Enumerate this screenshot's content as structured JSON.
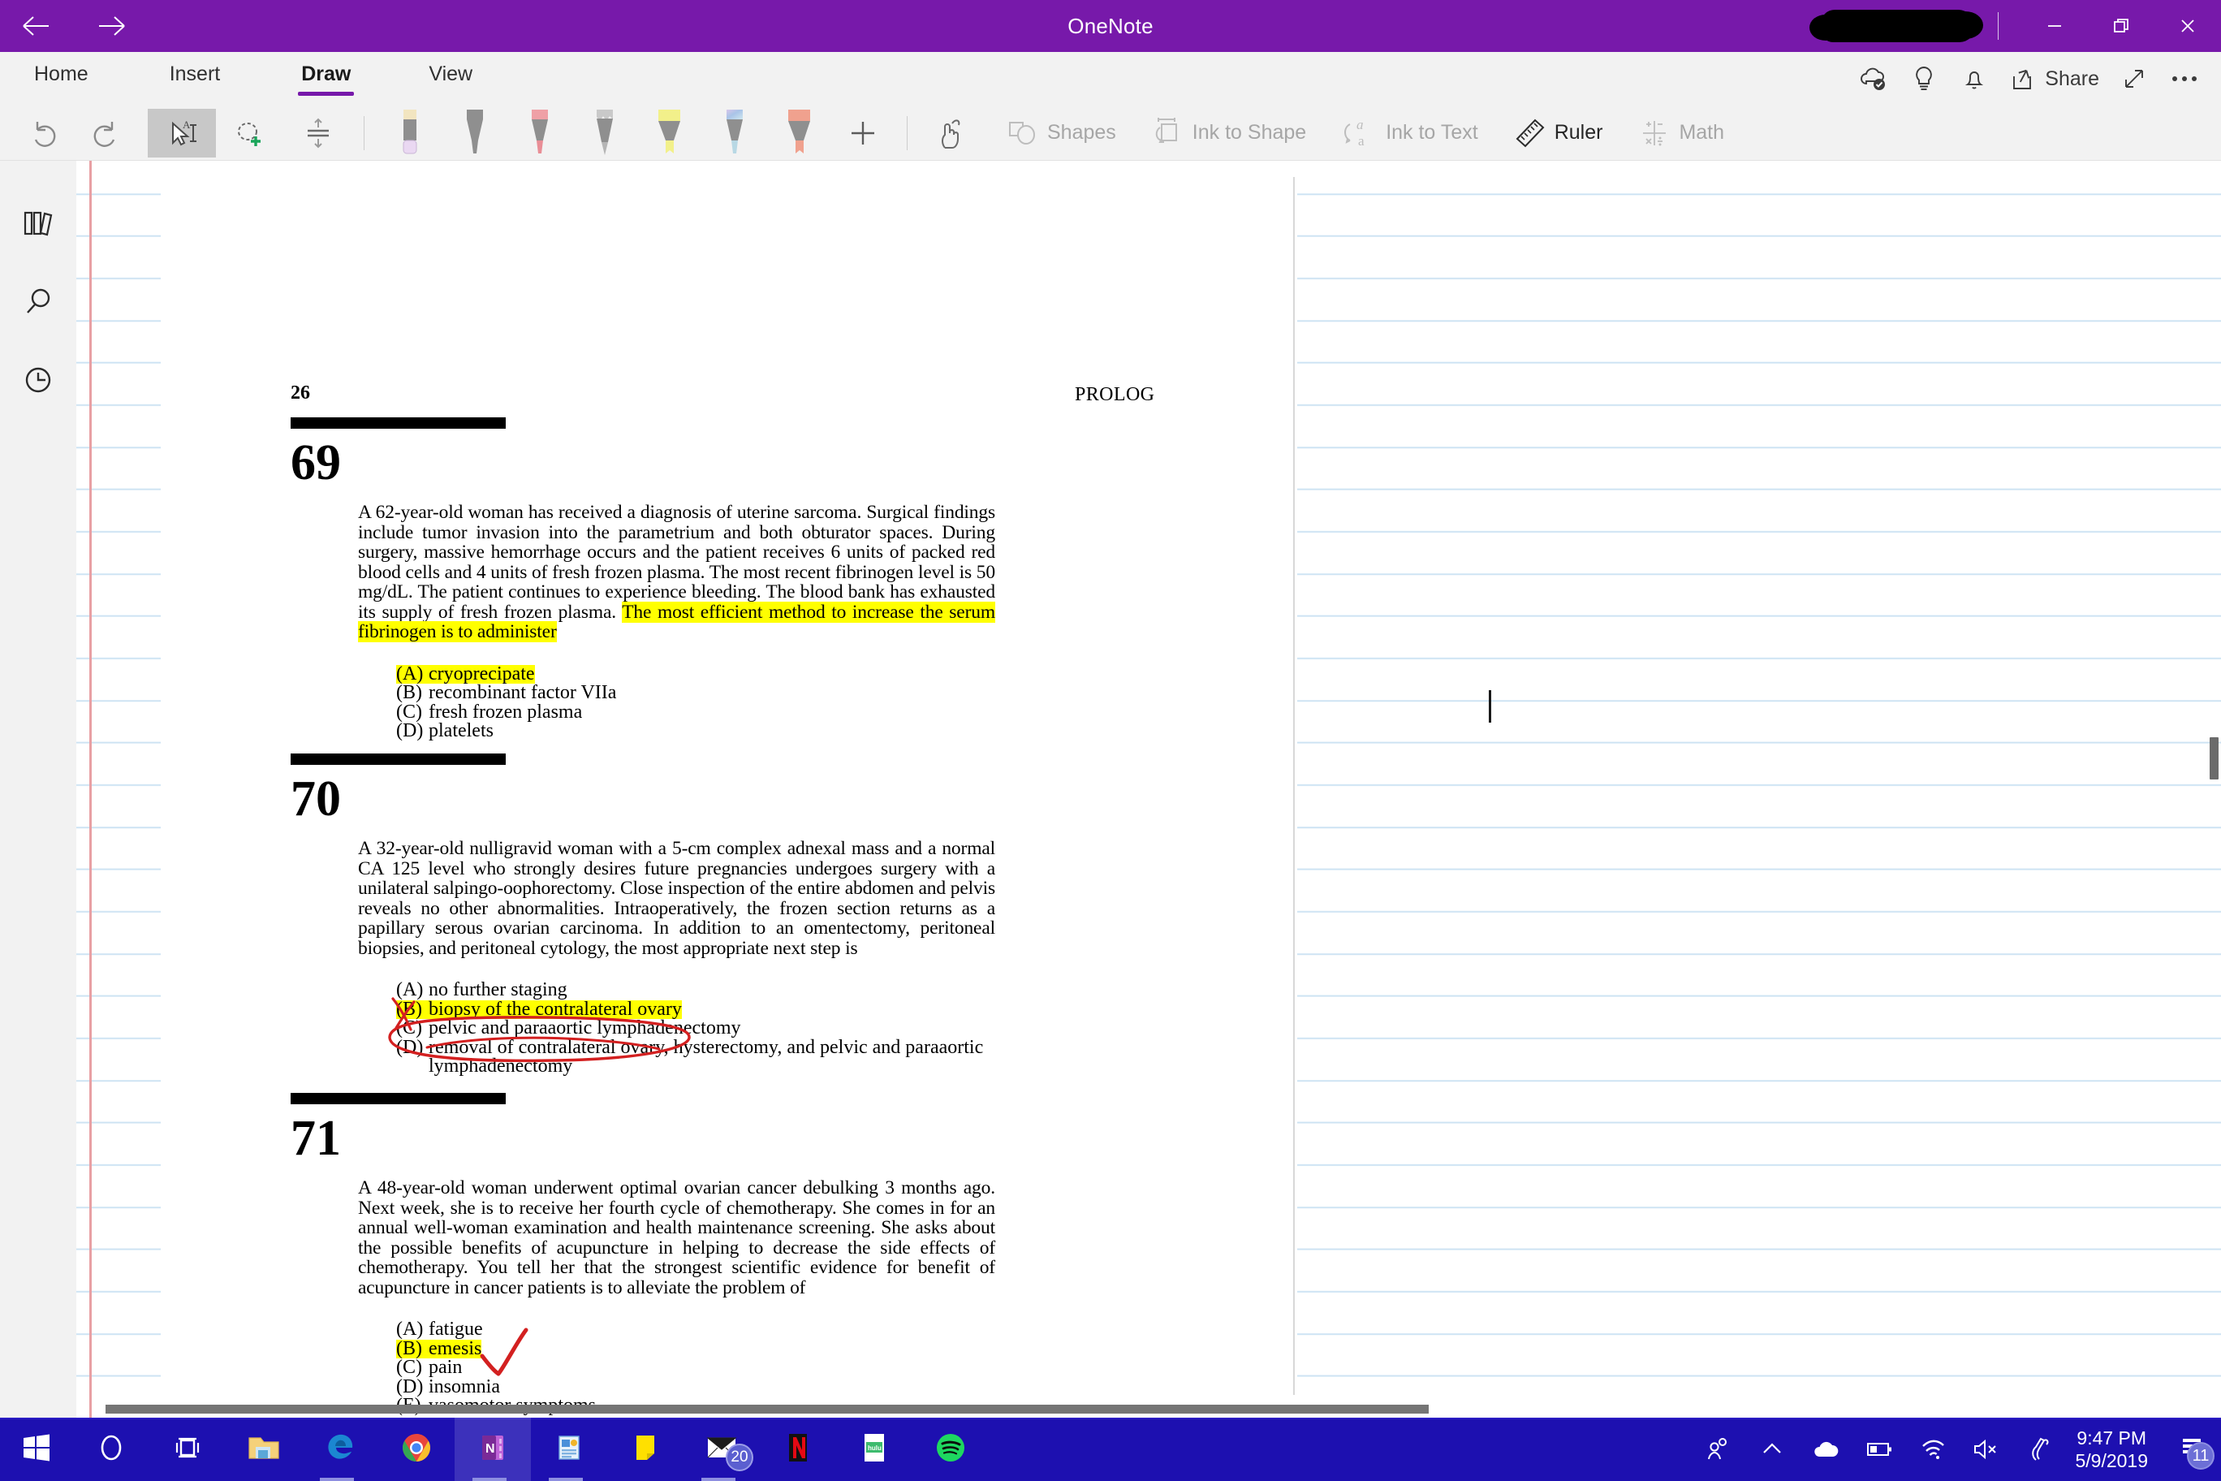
{
  "window": {
    "title": "OneNote",
    "back_icon": "back-arrow-icon",
    "forward_icon": "forward-arrow-icon",
    "minimize_label": "─",
    "restore_label": "❐",
    "close_label": "✕"
  },
  "ribbon": {
    "tabs": [
      {
        "label": "Home",
        "active": false
      },
      {
        "label": "Insert",
        "active": false
      },
      {
        "label": "Draw",
        "active": true
      },
      {
        "label": "View",
        "active": false
      }
    ],
    "right_actions": [
      {
        "label": "",
        "icon": "cloud-synced-icon"
      },
      {
        "label": "",
        "icon": "lightbulb-tellme-icon"
      },
      {
        "label": "",
        "icon": "bell-notification-icon"
      },
      {
        "label": "Share",
        "icon": "share-icon"
      },
      {
        "label": "",
        "icon": "expand-diagonal-icon"
      },
      {
        "label": "",
        "icon": "more-ellipsis-icon"
      }
    ]
  },
  "toolbar": {
    "undo": {
      "label": "",
      "icon": "undo-icon"
    },
    "redo": {
      "label": "",
      "icon": "redo-icon"
    },
    "type_select": {
      "label": "",
      "icon": "type-select-cursor-icon",
      "selected": true
    },
    "lasso_select": {
      "label": "",
      "icon": "lasso-select-icon"
    },
    "insert_space": {
      "label": "",
      "icon": "insert-space-icon"
    },
    "pens": [
      {
        "name": "eraser",
        "icon": "eraser-icon",
        "body": "#8b8b8b",
        "cap": "#f2e5c0",
        "tip": "#e8d5f0"
      },
      {
        "name": "pen-black",
        "icon": "pen-icon",
        "body": "#8b8b8b",
        "cap": "#8b8b8b",
        "tip": "#8b8b8b"
      },
      {
        "name": "pen-red",
        "icon": "pen-icon",
        "body": "#8b8b8b",
        "cap": "#efa0a6",
        "tip": "#e98e96"
      },
      {
        "name": "pencil-grey",
        "icon": "pencil-icon",
        "body": "#8b8b8b",
        "cap": "#c9c9c9",
        "tip": "#a8a8a8"
      },
      {
        "name": "highlighter-yellow",
        "icon": "highlighter-icon",
        "body": "#8b8b8b",
        "cap": "#f2f08a",
        "tip": "#f2f08a"
      },
      {
        "name": "pen-rainbow",
        "icon": "pen-icon",
        "body": "#8b8b8b",
        "cap": "#b9c9ea",
        "tip": "#b8d8e4"
      },
      {
        "name": "highlighter-orange",
        "icon": "highlighter-icon",
        "body": "#8b8b8b",
        "cap": "#f0a18e",
        "tip": "#f0a18e"
      }
    ],
    "add_pen": {
      "label": "+",
      "icon": "add-pen-icon"
    },
    "ink_to_select": {
      "label": "",
      "icon": "ink-finger-icon"
    },
    "shapes": {
      "label": "Shapes",
      "icon": "shapes-icon",
      "enabled": false
    },
    "ink_to_shape": {
      "label": "Ink to Shape",
      "icon": "ink-to-shape-icon",
      "enabled": false
    },
    "ink_to_text": {
      "label": "Ink to Text",
      "icon": "ink-to-text-icon",
      "enabled": false
    },
    "ruler": {
      "label": "Ruler",
      "icon": "ruler-icon",
      "enabled": true
    },
    "math": {
      "label": "Math",
      "icon": "math-icon",
      "enabled": false
    }
  },
  "rail": {
    "items": [
      {
        "name": "notebooks",
        "icon": "notebooks-icon"
      },
      {
        "name": "search",
        "icon": "search-icon"
      },
      {
        "name": "recent-notes",
        "icon": "clock-recent-icon"
      }
    ]
  },
  "document": {
    "page_number": "26",
    "running_head": "PROLOG",
    "questions": [
      {
        "number": "69",
        "stem_plain": "A 62-year-old woman has received a diagnosis of uterine sarcoma. Surgical findings include tumor invasion into the parametrium and both obturator spaces. During surgery, massive hemorrhage occurs and the patient receives 6 units of packed red blood cells and 4 units of fresh frozen plasma. The most recent fibrinogen level is 50 mg/dL. The patient continues to experience bleeding. The blood bank has exhausted its supply of fresh frozen plasma. ",
        "stem_highlight": "The most efficient method to increase the serum fibrinogen is to administer",
        "options": [
          {
            "letter": "(A)",
            "text": "cryoprecipate",
            "highlighted": true
          },
          {
            "letter": "(B)",
            "text": "recombinant factor VIIa",
            "highlighted": false
          },
          {
            "letter": "(C)",
            "text": "fresh frozen plasma",
            "highlighted": false
          },
          {
            "letter": "(D)",
            "text": "platelets",
            "highlighted": false
          }
        ]
      },
      {
        "number": "70",
        "stem_plain": "A 32-year-old nulligravid woman with a 5-cm complex adnexal mass and a normal CA 125 level who strongly desires future pregnancies undergoes surgery with a unilateral salpingo-oophorectomy. Close inspection of the entire abdomen and pelvis reveals no other abnormalities. Intraoperatively, the frozen section returns as a papillary serous ovarian carcinoma. In addition to an omentectomy, peritoneal biopsies, and peritoneal cytology, the most appropriate next step is",
        "stem_highlight": "",
        "options": [
          {
            "letter": "(A)",
            "text": "no further staging",
            "highlighted": false
          },
          {
            "letter": "(B)",
            "text": "biopsy of the contralateral ovary",
            "highlighted": true
          },
          {
            "letter": "(C)",
            "text": "pelvic and paraaortic lymphadenectomy",
            "highlighted": false
          },
          {
            "letter": "(D)",
            "text": "removal of contralateral ovary, hysterectomy, and pelvic and paraaortic lymphadenectomy",
            "highlighted": false
          }
        ]
      },
      {
        "number": "71",
        "stem_plain": "A 48-year-old woman underwent optimal ovarian cancer debulking 3 months ago. Next week, she is to receive her fourth cycle of chemotherapy. She comes in for an annual well-woman examination and health maintenance screening. She asks about the possible benefits of acupuncture in helping to decrease the side effects of chemotherapy. You tell her that the strongest scientific evidence for benefit of acupuncture in cancer patients is to alleviate the problem of",
        "stem_highlight": "",
        "options": [
          {
            "letter": "(A)",
            "text": "fatigue",
            "highlighted": false
          },
          {
            "letter": "(B)",
            "text": "emesis",
            "highlighted": true
          },
          {
            "letter": "(C)",
            "text": "pain",
            "highlighted": false
          },
          {
            "letter": "(D)",
            "text": "insomnia",
            "highlighted": false
          },
          {
            "letter": "(E)",
            "text": "vasomotor symptoms",
            "highlighted": false
          }
        ]
      }
    ],
    "annotations": [
      {
        "name": "red-x-over-option-b",
        "type": "x-mark",
        "color": "#d32020"
      },
      {
        "name": "red-circle-around-option-c",
        "type": "ellipse",
        "color": "#d32020"
      },
      {
        "name": "red-checkmark-next-to-emesis",
        "type": "check",
        "color": "#d32020"
      }
    ]
  },
  "colors": {
    "brand_purple": "#7719aa",
    "ribbon_bg": "#f2f2f2",
    "taskbar_blue": "#1d10b0",
    "highlight_yellow": "#ffff00",
    "ink_red": "#d32020",
    "rule_line": "#cde3f3",
    "margin_red": "#e8a0a4"
  },
  "taskbar": {
    "items": [
      {
        "name": "start",
        "label": "Start",
        "running": false
      },
      {
        "name": "cortana",
        "label": "Cortana",
        "running": false
      },
      {
        "name": "task-view",
        "label": "Task View",
        "running": false
      },
      {
        "name": "file-explorer",
        "label": "File Explorer",
        "running": false
      },
      {
        "name": "microsoft-edge",
        "label": "Microsoft Edge",
        "running": true
      },
      {
        "name": "google-chrome",
        "label": "Google Chrome",
        "running": false
      },
      {
        "name": "onenote",
        "label": "OneNote",
        "running": true,
        "active": true
      },
      {
        "name": "powerpoint",
        "label": "PowerPoint",
        "running": true
      },
      {
        "name": "sticky-notes",
        "label": "Sticky Notes",
        "running": false
      },
      {
        "name": "mail",
        "label": "Mail",
        "running": true,
        "badge": "20"
      },
      {
        "name": "netflix",
        "label": "Netflix",
        "running": false
      },
      {
        "name": "hulu",
        "label": "Hulu",
        "running": false
      },
      {
        "name": "spotify",
        "label": "Spotify",
        "running": false
      }
    ],
    "tray": [
      {
        "name": "people-icon",
        "label": "People"
      },
      {
        "name": "show-hidden-icons-chevron",
        "label": "Show hidden icons"
      },
      {
        "name": "onedrive-cloud-icon",
        "label": "OneDrive"
      },
      {
        "name": "battery-icon",
        "label": "Battery"
      },
      {
        "name": "wifi-icon",
        "label": "Network"
      },
      {
        "name": "volume-muted-icon",
        "label": "Volume muted"
      },
      {
        "name": "pen-workspace-icon",
        "label": "Windows Ink Workspace"
      }
    ],
    "clock": {
      "time": "9:47 PM",
      "date": "5/9/2019"
    },
    "action_center": {
      "icon": "action-center-icon",
      "badge": "11"
    }
  }
}
